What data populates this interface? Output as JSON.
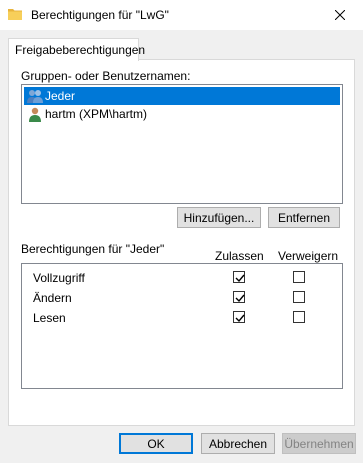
{
  "window": {
    "title": "Berechtigungen für \"LwG\"",
    "folder_icon": "folder-icon",
    "close_icon": "close-icon"
  },
  "tabs": [
    {
      "label": "Freigabeberechtigungen",
      "active": true
    }
  ],
  "groups_section": {
    "label": "Gruppen- oder Benutzernamen:",
    "items": [
      {
        "label": "Jeder",
        "icon": "users-group-icon",
        "selected": true
      },
      {
        "label": "hartm (XPM\\hartm)",
        "icon": "user-icon",
        "selected": false
      }
    ],
    "add_button": "Hinzufügen...",
    "remove_button": "Entfernen"
  },
  "permissions_section": {
    "label": "Berechtigungen für \"Jeder\"",
    "columns": {
      "allow": "Zulassen",
      "deny": "Verweigern"
    },
    "rows": [
      {
        "name": "Vollzugriff",
        "allow": true,
        "deny": false
      },
      {
        "name": "Ändern",
        "allow": true,
        "deny": false
      },
      {
        "name": "Lesen",
        "allow": true,
        "deny": false
      }
    ]
  },
  "footer": {
    "ok": "OK",
    "cancel": "Abbrechen",
    "apply": "Übernehmen",
    "apply_enabled": false
  },
  "colors": {
    "selection": "#0078d7",
    "dialog_background": "#f0f0f0",
    "panel_background": "#ffffff"
  }
}
